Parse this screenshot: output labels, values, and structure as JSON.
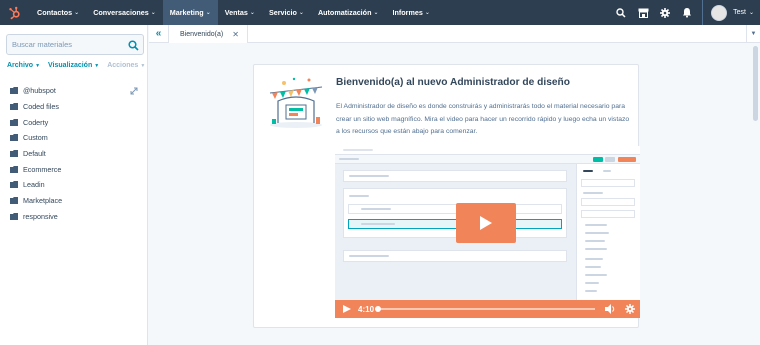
{
  "topnav": {
    "items": [
      {
        "label": "Contactos",
        "active": false
      },
      {
        "label": "Conversaciones",
        "active": false
      },
      {
        "label": "Marketing",
        "active": true
      },
      {
        "label": "Ventas",
        "active": false
      },
      {
        "label": "Servicio",
        "active": false
      },
      {
        "label": "Automatización",
        "active": false
      },
      {
        "label": "Informes",
        "active": false
      }
    ],
    "caret": "⌄",
    "right_icons": [
      "search-icon",
      "marketplace-icon",
      "settings-icon",
      "notifications-icon"
    ],
    "user_name": "Test",
    "colors": {
      "bar": "#2d3e50",
      "active": "#425b76",
      "text": "#ffffff"
    }
  },
  "sidebar": {
    "search_placeholder": "Buscar materiales",
    "menu": [
      {
        "label": "Archivo",
        "disabled": false
      },
      {
        "label": "Visualización",
        "disabled": false
      },
      {
        "label": "Acciones",
        "disabled": true
      }
    ],
    "folders": [
      "@hubspot",
      "Coded files",
      "Coderty",
      "Custom",
      "Default",
      "Ecommerce",
      "Leadin",
      "Marketplace",
      "responsive"
    ]
  },
  "tabs": {
    "collapse_label": "«",
    "active_tab": "Bienvenido(a)",
    "close_label": "✕"
  },
  "welcome": {
    "title": "Bienvenido(a) al nuevo Administrador de diseño",
    "body": "El Administrador de diseño es donde construirás y administrarás todo el material necesario para crear un sitio web magnífico. Mira el video para hacer un recorrido rápido y luego echa un vistazo a los recursos que están abajo para comenzar.",
    "video_time": "4:10",
    "accent_color": "#f2845a"
  }
}
